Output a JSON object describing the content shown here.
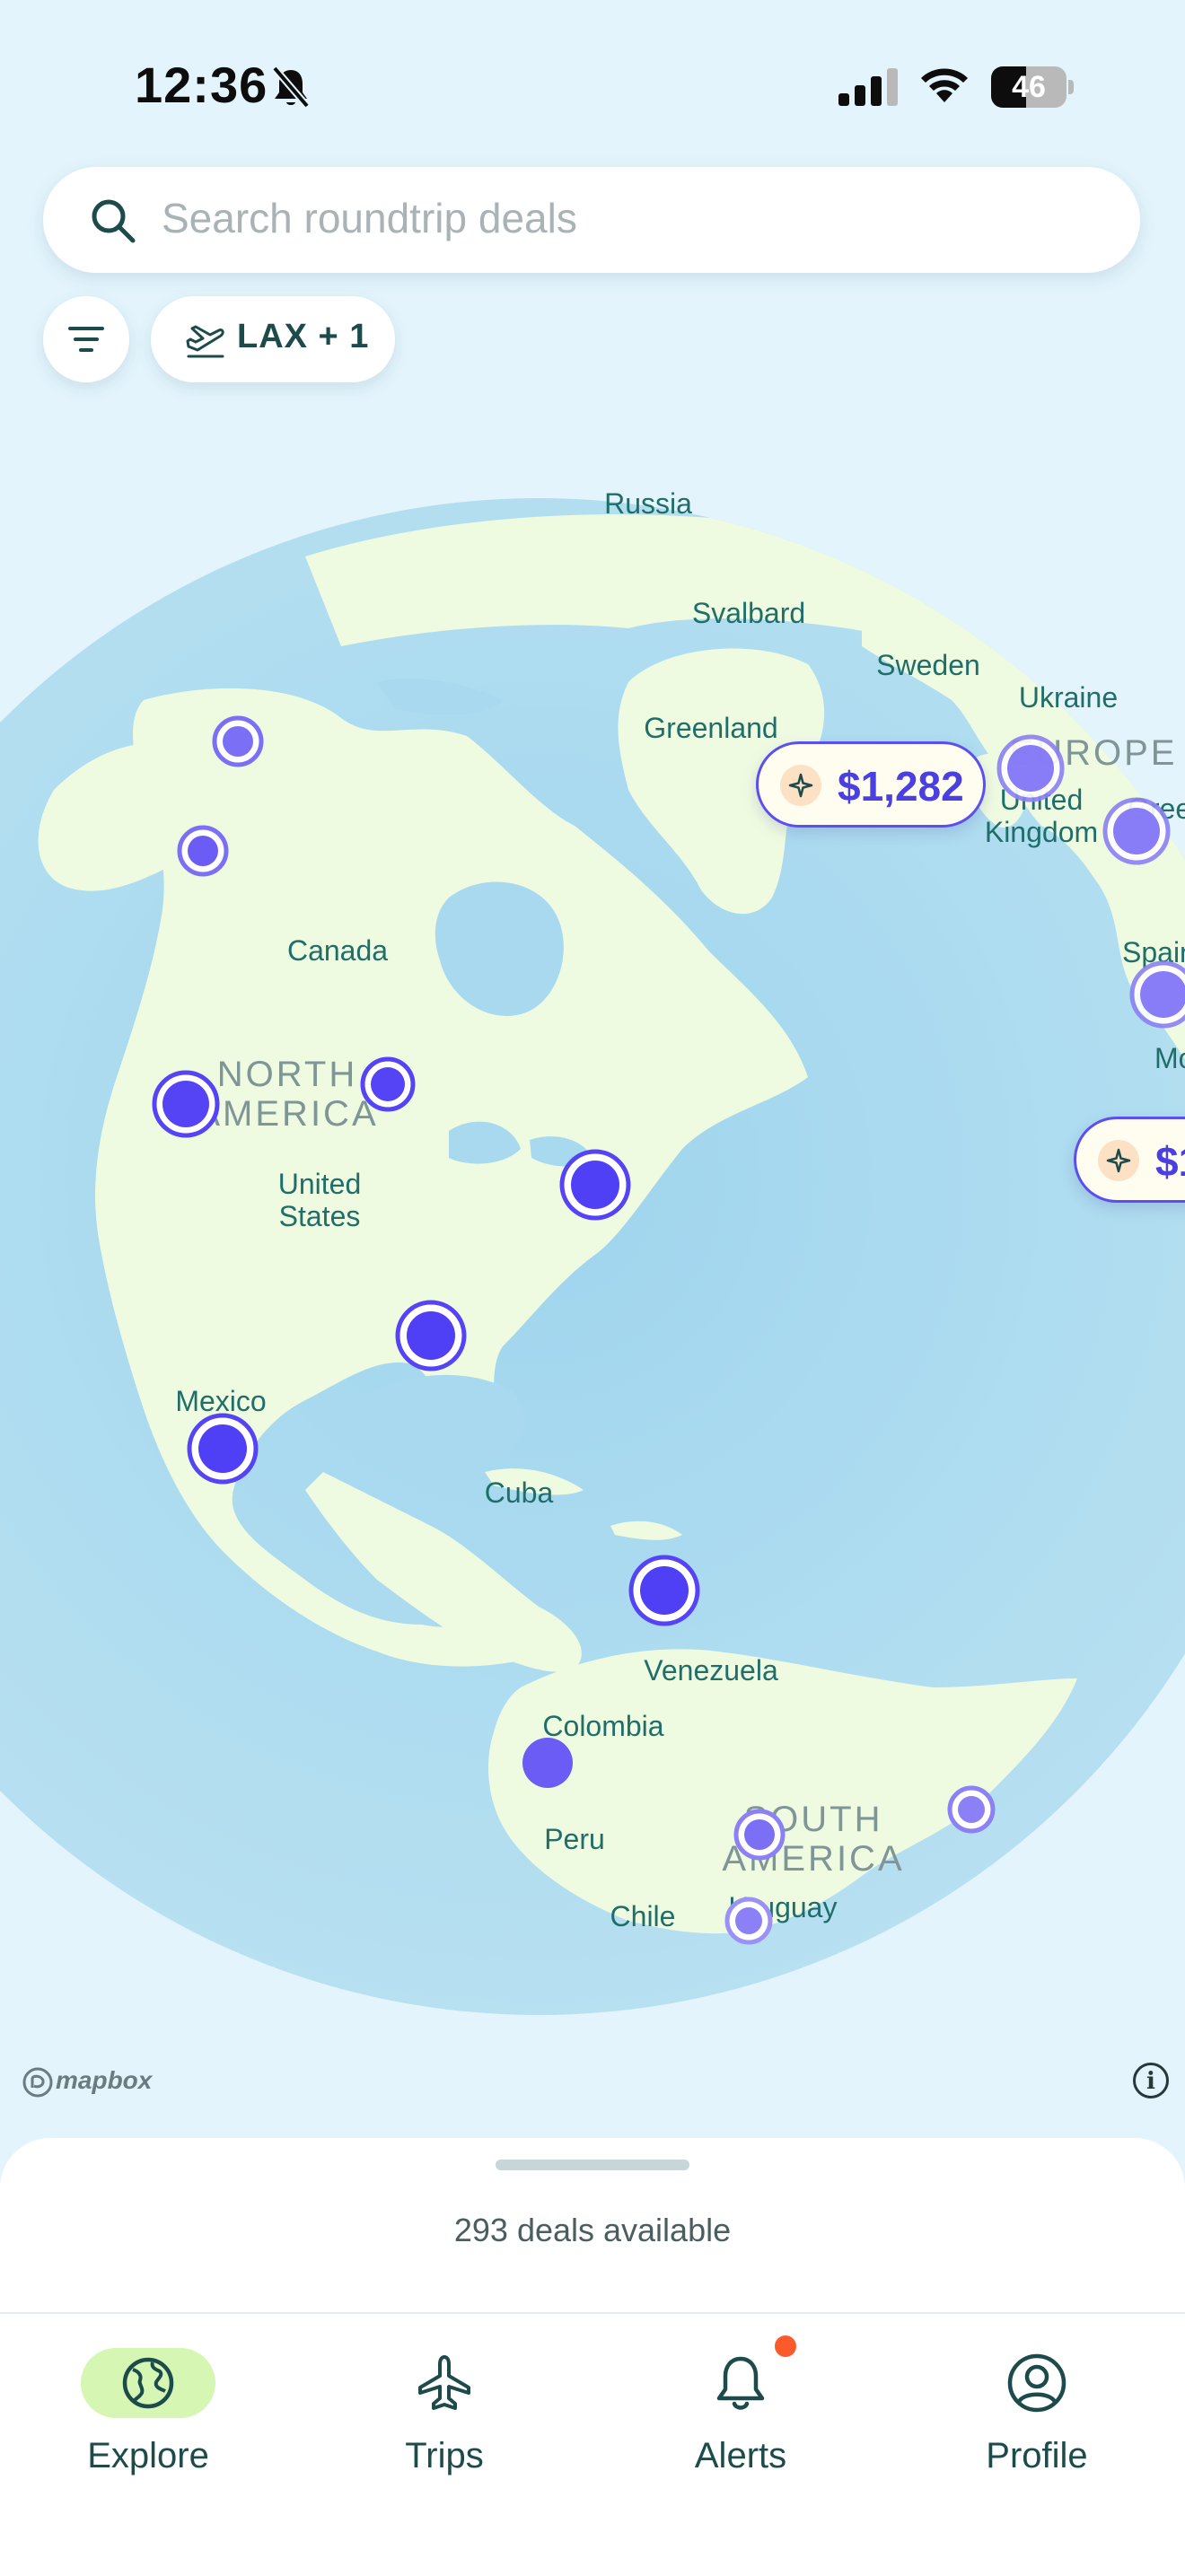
{
  "status_bar": {
    "time": "12:36",
    "battery_level": "46",
    "battery_fraction": 0.46
  },
  "search": {
    "placeholder": "Search roundtrip deals"
  },
  "filters": {
    "airport_chip_label": "LAX + 1"
  },
  "map": {
    "labels": {
      "russia": "Russia",
      "svalbard": "Svalbard",
      "sweden": "Sweden",
      "ukraine": "Ukraine",
      "greenland": "Greenland",
      "europe": "EUROPE",
      "united_kingdom_line1": "United",
      "united_kingdom_line2": "Kingdom",
      "greece_partial": "Gree",
      "spain_partial": "Spain",
      "morocco_partial": "Mo",
      "canada": "Canada",
      "north_america_line1": "NORTH",
      "north_america_line2": "AMERICA",
      "united_states_line1": "United",
      "united_states_line2": "States",
      "mexico": "Mexico",
      "cuba": "Cuba",
      "venezuela": "Venezuela",
      "colombia": "Colombia",
      "peru": "Peru",
      "south_america_line1": "SOUTH",
      "south_america_line2": "AMERICA",
      "chile": "Chile",
      "uruguay": "Uruguay"
    },
    "deal_pins": {
      "europe_price": "$1,282",
      "partial_price": "$1"
    },
    "attribution": "mapbox"
  },
  "bottom_sheet": {
    "deals_count": "293 deals available"
  },
  "tabs": [
    {
      "label": "Explore",
      "icon": "globe-icon",
      "active": true
    },
    {
      "label": "Trips",
      "icon": "airplane-icon",
      "active": false
    },
    {
      "label": "Alerts",
      "icon": "bell-icon",
      "active": false,
      "has_notification": true
    },
    {
      "label": "Profile",
      "icon": "profile-icon",
      "active": false
    }
  ],
  "colors": {
    "accent": "#5b4ff0",
    "pin": "#5544f5",
    "active_tab_bg": "#d6f6b3",
    "notification": "#fb5a2a",
    "land": "#effbe1",
    "water": "#a8d9ef"
  }
}
